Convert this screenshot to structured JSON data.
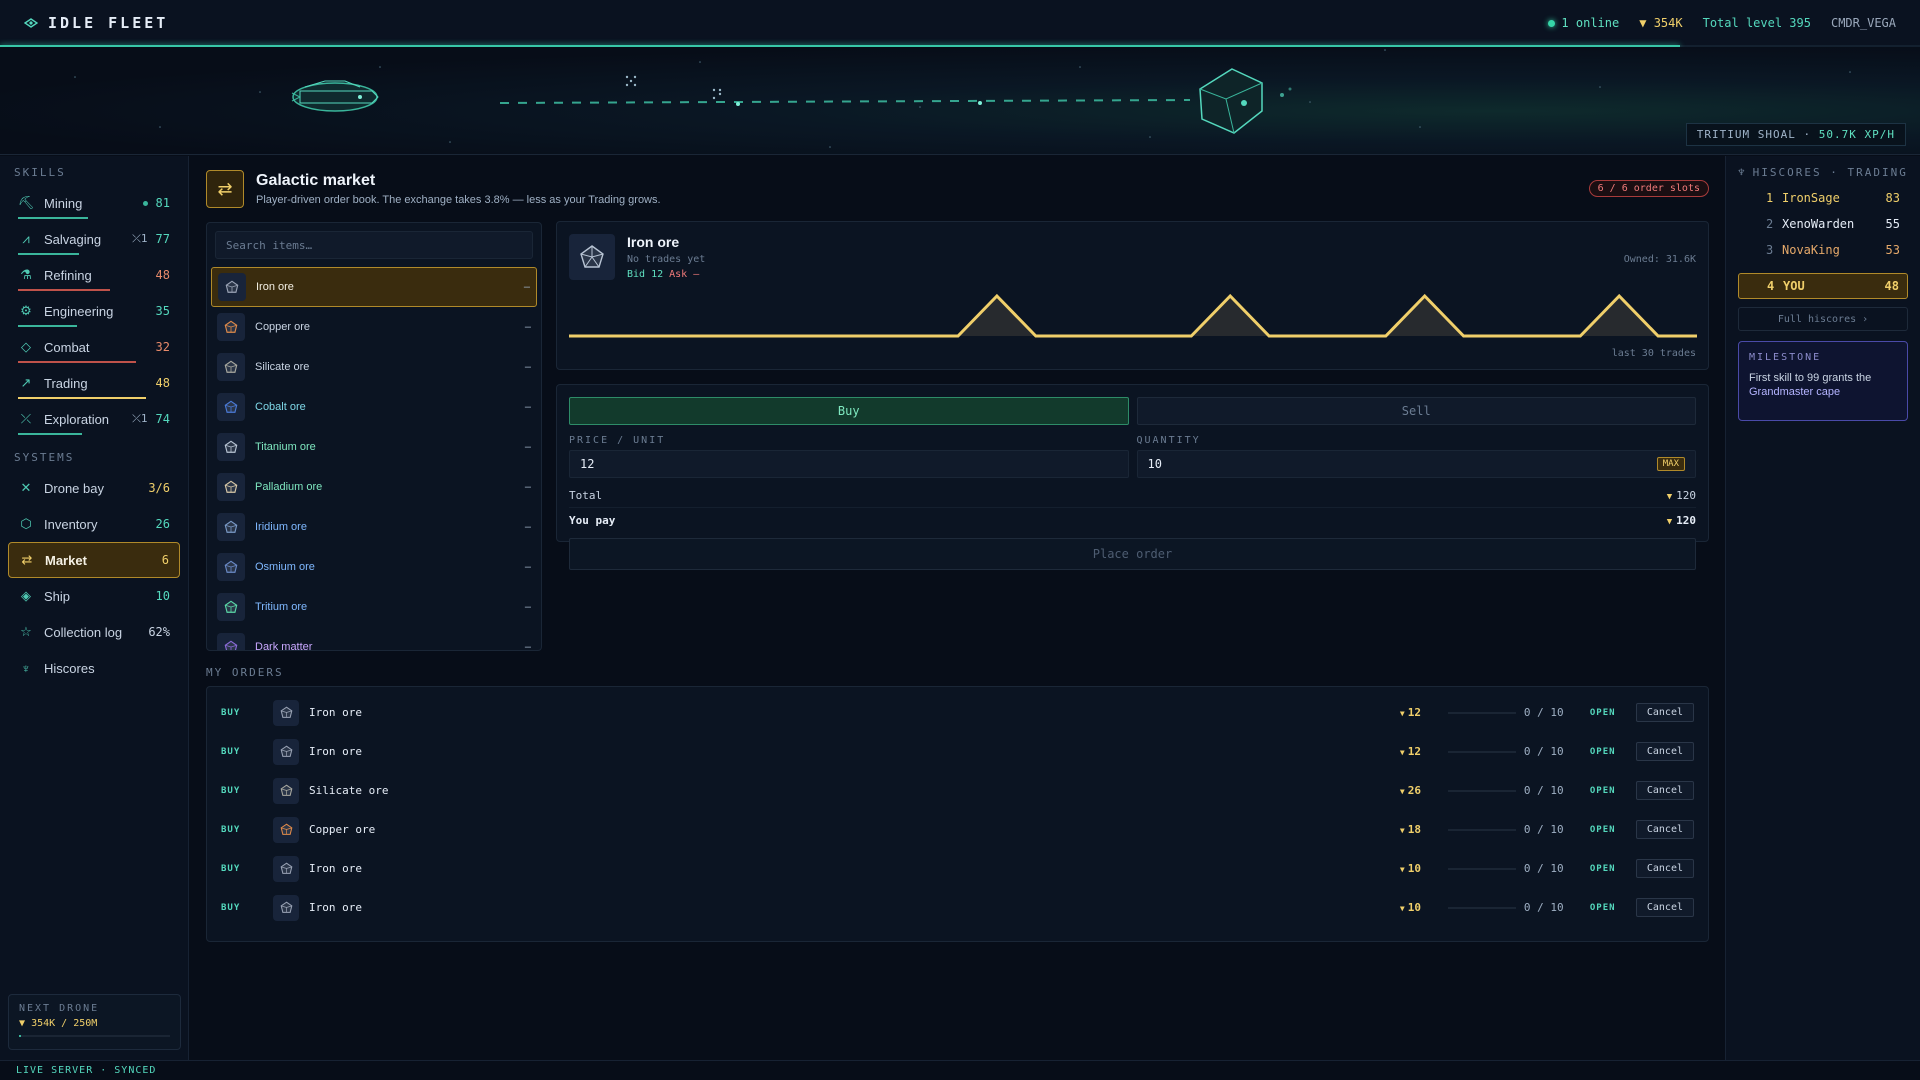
{
  "topbar": {
    "brand": "IDLE FLEET",
    "online": "1 online",
    "credits": "354K",
    "total_level": "Total level 395",
    "username": "CMDR_VEGA",
    "xp_progress": 0.875
  },
  "scene": {
    "zone": "TRITIUM SHOAL",
    "separator": "·",
    "rate": "50.7K XP/H"
  },
  "sidebar": {
    "skills_heading": "SKILLS",
    "skills": [
      {
        "label": "Mining",
        "value": "81",
        "color": "#54d8bd",
        "icon": "pickaxe-icon",
        "glyph": "⛏",
        "marker": "dot",
        "progress": 0.55
      },
      {
        "label": "Salvaging",
        "value": "77",
        "color": "#54d8bd",
        "icon": "salvage-icon",
        "glyph": "⩘",
        "extra": "⤫1",
        "progress": 0.48
      },
      {
        "label": "Refining",
        "value": "48",
        "color": "#e88a6a",
        "icon": "flask-icon",
        "glyph": "⚗",
        "progress": 0.72
      },
      {
        "label": "Engineering",
        "value": "35",
        "color": "#54d8bd",
        "icon": "gear-icon",
        "glyph": "⚙",
        "progress": 0.46
      },
      {
        "label": "Combat",
        "value": "32",
        "color": "#e88a6a",
        "icon": "crosshair-icon",
        "glyph": "◇",
        "progress": 0.92
      },
      {
        "label": "Trading",
        "value": "48",
        "color": "#f0cf6a",
        "icon": "chart-icon",
        "glyph": "↗",
        "progress": 1.0
      },
      {
        "label": "Exploration",
        "value": "74",
        "color": "#54d8bd",
        "icon": "compass-icon",
        "glyph": "⤫",
        "extra": "⤫1",
        "progress": 0.5
      }
    ],
    "systems_heading": "SYSTEMS",
    "systems": [
      {
        "label": "Drone bay",
        "value": "3/6",
        "color": "#f0cf6a",
        "icon": "drone-icon",
        "glyph": "✕"
      },
      {
        "label": "Inventory",
        "value": "26",
        "color": "#54d8bd",
        "icon": "cube-icon",
        "glyph": "⬡"
      },
      {
        "label": "Market",
        "value": "6",
        "color": "#f0cf6a",
        "icon": "exchange-icon",
        "glyph": "⇄",
        "active": true
      },
      {
        "label": "Ship",
        "value": "10",
        "color": "#54d8bd",
        "icon": "ship-icon",
        "glyph": "◈"
      },
      {
        "label": "Collection log",
        "value": "62%",
        "color": "#c9d4e3",
        "icon": "star-icon",
        "glyph": "☆"
      },
      {
        "label": "Hiscores",
        "value": "",
        "color": "#c9d4e3",
        "icon": "trophy-icon",
        "glyph": "♆"
      }
    ],
    "next_drone": {
      "title": "NEXT DRONE",
      "value": "354K / 250M",
      "progress": 0.0014
    }
  },
  "status": "LIVE SERVER · SYNCED",
  "market": {
    "title": "Galactic market",
    "subtitle": "Player-driven order book. The exchange takes 3.8% — less as your Trading grows.",
    "slots": "6 / 6 order slots",
    "search_placeholder": "Search items…",
    "items": [
      {
        "name": "Iron ore",
        "price": "–",
        "color": "#c9d4e3",
        "gem": "#9aa3b5",
        "selected": true
      },
      {
        "name": "Copper ore",
        "price": "–",
        "color": "#c9d4e3",
        "gem": "#e08a4a"
      },
      {
        "name": "Silicate ore",
        "price": "–",
        "color": "#c9d4e3",
        "gem": "#a9a9a0"
      },
      {
        "name": "Cobalt ore",
        "price": "–",
        "color": "#7fd8e8",
        "gem": "#4a7ad8"
      },
      {
        "name": "Titanium ore",
        "price": "–",
        "color": "#7fe8c0",
        "gem": "#b8c4d4"
      },
      {
        "name": "Palladium ore",
        "price": "–",
        "color": "#7fe8c0",
        "gem": "#d8c8a8"
      },
      {
        "name": "Iridium ore",
        "price": "–",
        "color": "#7fb8ff",
        "gem": "#7a9ac8"
      },
      {
        "name": "Osmium ore",
        "price": "–",
        "color": "#7fb8ff",
        "gem": "#6a8ac8"
      },
      {
        "name": "Tritium ore",
        "price": "–",
        "color": "#7fb8ff",
        "gem": "#5ad8a8"
      },
      {
        "name": "Dark matter",
        "price": "–",
        "color": "#c9a8ff",
        "gem": "#8a6ad8"
      }
    ],
    "detail": {
      "name": "Iron ore",
      "note": "No trades yet",
      "bid": "Bid 12",
      "ask": "Ask –",
      "owned": "Owned: 31.6K",
      "caption": "last 30 trades",
      "series": [
        0,
        0,
        0,
        0,
        0,
        0,
        0,
        0,
        0,
        0,
        0,
        1,
        0,
        0,
        0,
        0,
        0,
        1,
        0,
        0,
        0,
        0,
        1,
        0,
        0,
        0,
        0,
        1,
        0,
        0
      ]
    },
    "form": {
      "buy": "Buy",
      "sell": "Sell",
      "price_label": "PRICE / UNIT",
      "price": "12",
      "qty_label": "QUANTITY",
      "qty": "10",
      "max": "MAX",
      "total_label": "Total",
      "total": "120",
      "pay_label": "You pay",
      "pay": "120",
      "place": "Place order"
    },
    "orders_heading": "MY ORDERS",
    "orders": [
      {
        "side": "BUY",
        "item": "Iron ore",
        "gem": "#9aa3b5",
        "price": "12",
        "filled": "0 / 10",
        "status": "OPEN",
        "action": "Cancel"
      },
      {
        "side": "BUY",
        "item": "Iron ore",
        "gem": "#9aa3b5",
        "price": "12",
        "filled": "0 / 10",
        "status": "OPEN",
        "action": "Cancel"
      },
      {
        "side": "BUY",
        "item": "Silicate ore",
        "gem": "#a9a9a0",
        "price": "26",
        "filled": "0 / 10",
        "status": "OPEN",
        "action": "Cancel"
      },
      {
        "side": "BUY",
        "item": "Copper ore",
        "gem": "#e08a4a",
        "price": "18",
        "filled": "0 / 10",
        "status": "OPEN",
        "action": "Cancel"
      },
      {
        "side": "BUY",
        "item": "Iron ore",
        "gem": "#9aa3b5",
        "price": "10",
        "filled": "0 / 10",
        "status": "OPEN",
        "action": "Cancel"
      },
      {
        "side": "BUY",
        "item": "Iron ore",
        "gem": "#9aa3b5",
        "price": "10",
        "filled": "0 / 10",
        "status": "OPEN",
        "action": "Cancel"
      }
    ]
  },
  "hiscores": {
    "heading": "HISCORES · TRADING",
    "entries": [
      {
        "rank": "1",
        "name": "IronSage",
        "level": "83"
      },
      {
        "rank": "2",
        "name": "XenoWarden",
        "level": "55"
      },
      {
        "rank": "3",
        "name": "NovaKing",
        "level": "53"
      }
    ],
    "you": {
      "rank": "4",
      "name": "YOU",
      "level": "48"
    },
    "full": "Full hiscores ›",
    "milestone_title": "MILESTONE",
    "milestone_text": "First skill to 99 grants the",
    "milestone_reward": "Grandmaster cape"
  },
  "colors": {
    "accent": "#54d8bd",
    "gold": "#f0cf6a",
    "danger": "#f07a7a"
  }
}
